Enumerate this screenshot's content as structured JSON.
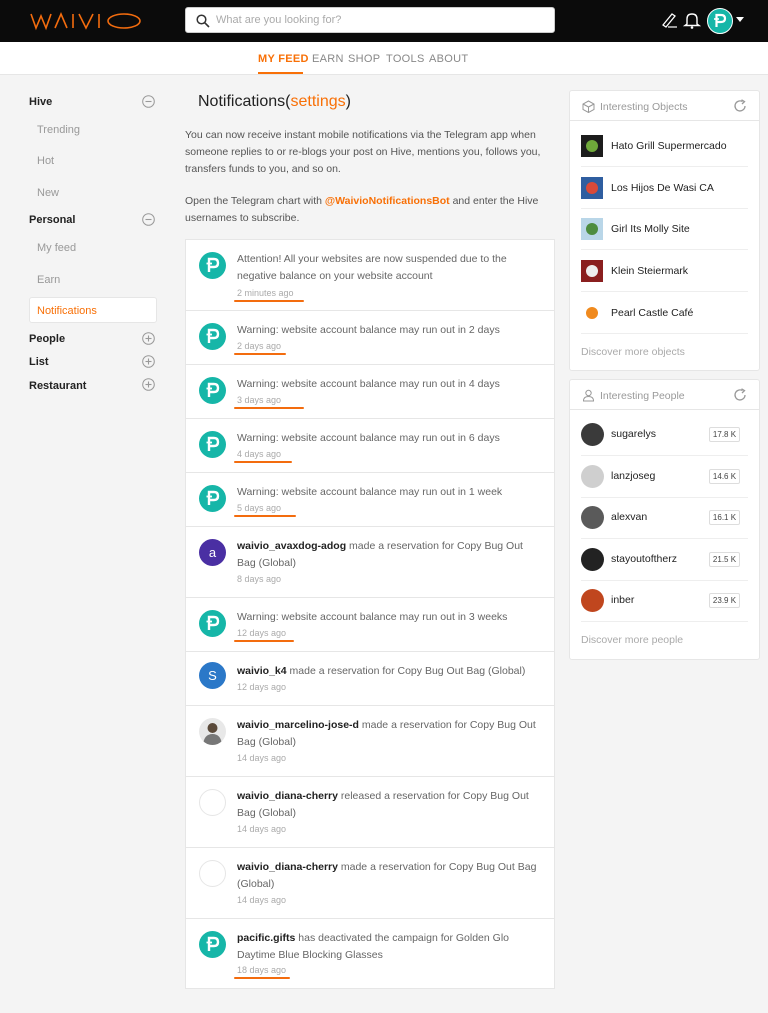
{
  "header": {
    "logo_text": "WAIVIO",
    "search_placeholder": "What are you looking for?"
  },
  "nav": {
    "items": [
      "MY FEED",
      "EARN",
      "SHOP",
      "TOOLS",
      "ABOUT"
    ],
    "active": "MY FEED"
  },
  "sidebar": {
    "hive": {
      "label": "Hive",
      "items": [
        "Trending",
        "Hot",
        "New"
      ]
    },
    "personal": {
      "label": "Personal",
      "items": [
        "My feed",
        "Earn",
        "Notifications"
      ],
      "active": "Notifications"
    },
    "collapsed": [
      "People",
      "List",
      "Restaurant"
    ]
  },
  "main": {
    "title": "Notifications",
    "title_link": "settings",
    "intro_1": "You can now receive instant mobile notifications via the Telegram app when someone replies to or re-blogs your post on Hive, mentions you, follows you, transfers funds to you, and so on.",
    "intro_2_before": "Open the Telegram chart with ",
    "intro_2_bot": "@WaivioNotificationsBot",
    "intro_2_after": " and enter the Hive usernames to subscribe.",
    "notifications": [
      {
        "user": "",
        "message": "Attention! All your websites are now suspended due to the negative balance on your website account",
        "time": "2 minutes ago",
        "avatar": "waivio-logo"
      },
      {
        "user": "",
        "message": "Warning: website account balance may run out in 2 days",
        "time": "2 days ago",
        "avatar": "waivio-logo"
      },
      {
        "user": "",
        "message": "Warning: website account balance may run out in 4 days",
        "time": "3 days ago",
        "avatar": "waivio-logo"
      },
      {
        "user": "",
        "message": "Warning: website account balance may run out in 6 days",
        "time": "4 days ago",
        "avatar": "waivio-logo"
      },
      {
        "user": "",
        "message": "Warning: website account balance may run out in 1 week",
        "time": "5 days ago",
        "avatar": "waivio-logo"
      },
      {
        "user": "waivio_avaxdog-adog",
        "message": " made a reservation for Copy Bug Out Bag (Global)",
        "time": "8 days ago",
        "avatar": "letter-a",
        "avatar_letter": "a"
      },
      {
        "user": "",
        "message": "Warning: website account balance may run out in 3 weeks",
        "time": "12 days ago",
        "avatar": "waivio-logo"
      },
      {
        "user": "waivio_k4",
        "message": " made a reservation for Copy Bug Out Bag (Global)",
        "time": "12 days ago",
        "avatar": "letter-s",
        "avatar_letter": "S"
      },
      {
        "user": "waivio_marcelino-jose-d",
        "message": " made a reservation for Copy Bug Out Bag (Global)",
        "time": "14 days ago",
        "avatar": "photo"
      },
      {
        "user": "waivio_diana-cherry",
        "message": " released a reservation for Copy Bug Out Bag (Global)",
        "time": "14 days ago",
        "avatar": "blank"
      },
      {
        "user": "waivio_diana-cherry",
        "message": " made a reservation for Copy Bug Out Bag (Global)",
        "time": "14 days ago",
        "avatar": "blank"
      },
      {
        "user": "pacific.gifts",
        "message": " has deactivated the campaign for Golden Glo Daytime Blue Blocking Glasses",
        "time": "18 days ago",
        "avatar": "waivio-logo"
      }
    ]
  },
  "objects_panel": {
    "title": "Interesting Objects",
    "items": [
      "Hato Grill Supermercado",
      "Los Hijos De Wasi CA",
      "Girl Its Molly Site",
      "Klein Steiermark",
      "Pearl Castle Café"
    ],
    "discover": "Discover more objects"
  },
  "people_panel": {
    "title": "Interesting People",
    "items": [
      {
        "name": "sugarelys",
        "badge": "17.8 K"
      },
      {
        "name": "lanzjoseg",
        "badge": "14.6 K"
      },
      {
        "name": "alexvan",
        "badge": "16.1 K"
      },
      {
        "name": "stayoutoftherz",
        "badge": "21.5 K"
      },
      {
        "name": "inber",
        "badge": "23.9 K"
      }
    ],
    "discover": "Discover more people"
  },
  "colors": {
    "accent": "#f87007",
    "teal": "#16b6a8",
    "header": "#0b0b0b"
  }
}
